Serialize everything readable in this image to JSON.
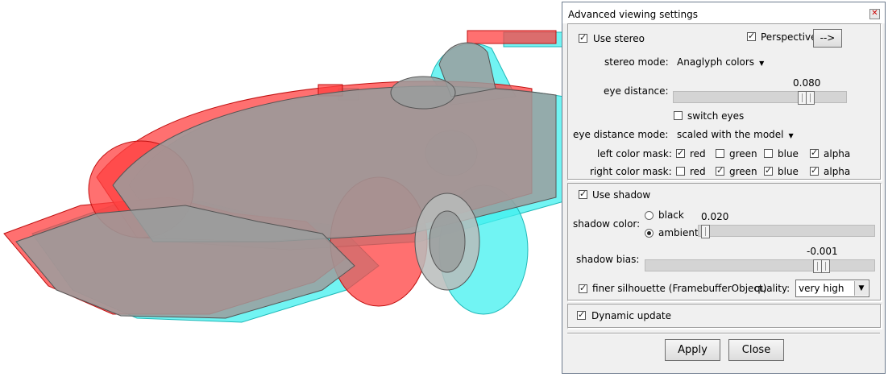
{
  "dialog": {
    "title": "Advanced viewing settings",
    "close_glyph": "✕",
    "stereo": {
      "use_stereo_label": "Use stereo",
      "use_stereo_checked": true,
      "perspective_label": "Perspective",
      "perspective_checked": true,
      "arrow_button_label": "-->",
      "stereo_mode_label": "stereo mode:",
      "stereo_mode_value": "Anaglyph colors",
      "eye_distance_label": "eye distance:",
      "eye_distance_value": "0.080",
      "switch_eyes_label": "switch eyes",
      "switch_eyes_checked": false,
      "eye_distance_mode_label": "eye distance mode:",
      "eye_distance_mode_value": "scaled with the model",
      "left_mask_label": "left color mask:",
      "right_mask_label": "right color mask:",
      "mask_channels": [
        "red",
        "green",
        "blue",
        "alpha"
      ],
      "left_mask": [
        true,
        false,
        false,
        true
      ],
      "right_mask": [
        false,
        true,
        true,
        true
      ]
    },
    "shadow": {
      "use_shadow_label": "Use shadow",
      "use_shadow_checked": true,
      "shadow_color_label": "shadow color:",
      "black_label": "black",
      "ambient_label": "ambient",
      "selected_color": "ambient",
      "ambient_value": "0.020",
      "shadow_bias_label": "shadow bias:",
      "shadow_bias_value": "-0.001",
      "finer_silhouette_label": "finer silhouette (FramebufferObject)",
      "finer_silhouette_checked": true,
      "quality_label": "quality:",
      "quality_value": "very high"
    },
    "dynamic_update_label": "Dynamic update",
    "dynamic_update_checked": true,
    "apply_label": "Apply",
    "close_label": "Close"
  },
  "colors": {
    "anaglyph_red": "#ff3b3b",
    "anaglyph_cyan": "#3ef2f2",
    "body_gray": "#8a8f8e"
  }
}
